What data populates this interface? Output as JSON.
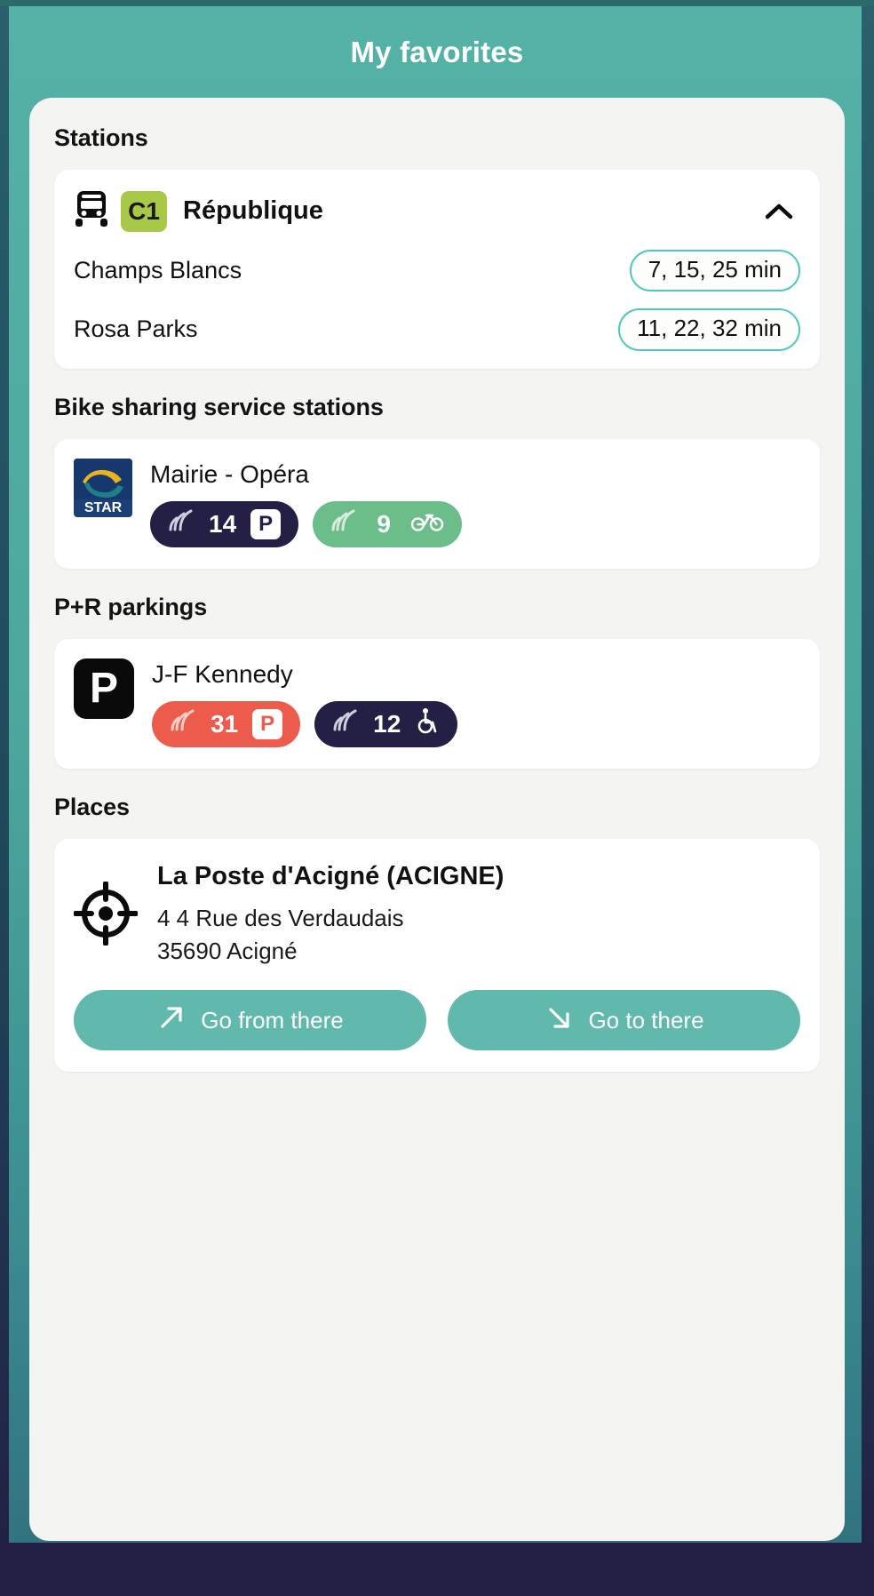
{
  "header": {
    "title": "My favorites"
  },
  "theme": {
    "header_teal": "#4da79d",
    "accent_teal": "#61b9ad",
    "pill_border": "#4ec9bb",
    "line_badge_green": "#a8c84a",
    "badge_dark": "#231f45",
    "badge_green": "#6bbd89",
    "badge_red": "#ec5b4b",
    "sheet_bg": "#f4f5f3",
    "card_bg": "#ffffff"
  },
  "sections": {
    "stations": {
      "title": "Stations",
      "items": [
        {
          "line": "C1",
          "mode_icon": "bus-icon",
          "name": "République",
          "expanded": true,
          "toggle_icon": "chevron-up-icon",
          "destinations": [
            {
              "name": "Champs Blancs",
              "times": "7, 15, 25 min"
            },
            {
              "name": "Rosa Parks",
              "times": "11, 22, 32 min"
            }
          ]
        }
      ]
    },
    "bike_stations": {
      "title": "Bike sharing service stations",
      "items": [
        {
          "operator_logo": "star-logo",
          "operator_name": "STAR",
          "name": "Mairie - Opéra",
          "badges": [
            {
              "icon": "signal-icon",
              "count": "14",
              "kind_icon": "parking-p-icon",
              "style": "dark"
            },
            {
              "icon": "signal-icon",
              "count": "9",
              "kind_icon": "bicycle-icon",
              "style": "green"
            }
          ]
        }
      ]
    },
    "parkings": {
      "title": "P+R parkings",
      "items": [
        {
          "logo_icon": "parking-p-icon",
          "logo_letter": "P",
          "name": "J-F Kennedy",
          "badges": [
            {
              "icon": "signal-icon",
              "count": "31",
              "kind_icon": "parking-p-icon",
              "style": "red"
            },
            {
              "icon": "signal-icon",
              "count": "12",
              "kind_icon": "wheelchair-icon",
              "style": "dark"
            }
          ]
        }
      ]
    },
    "places": {
      "title": "Places",
      "items": [
        {
          "icon": "crosshair-icon",
          "name": "La Poste d'Acigné (ACIGNE)",
          "address_line1": "4 4 Rue des Verdaudais",
          "address_line2": "35690 Acigné",
          "actions": [
            {
              "label": "Go from there",
              "icon": "arrow-up-right-icon"
            },
            {
              "label": "Go to there",
              "icon": "arrow-down-right-icon"
            }
          ]
        }
      ]
    }
  }
}
